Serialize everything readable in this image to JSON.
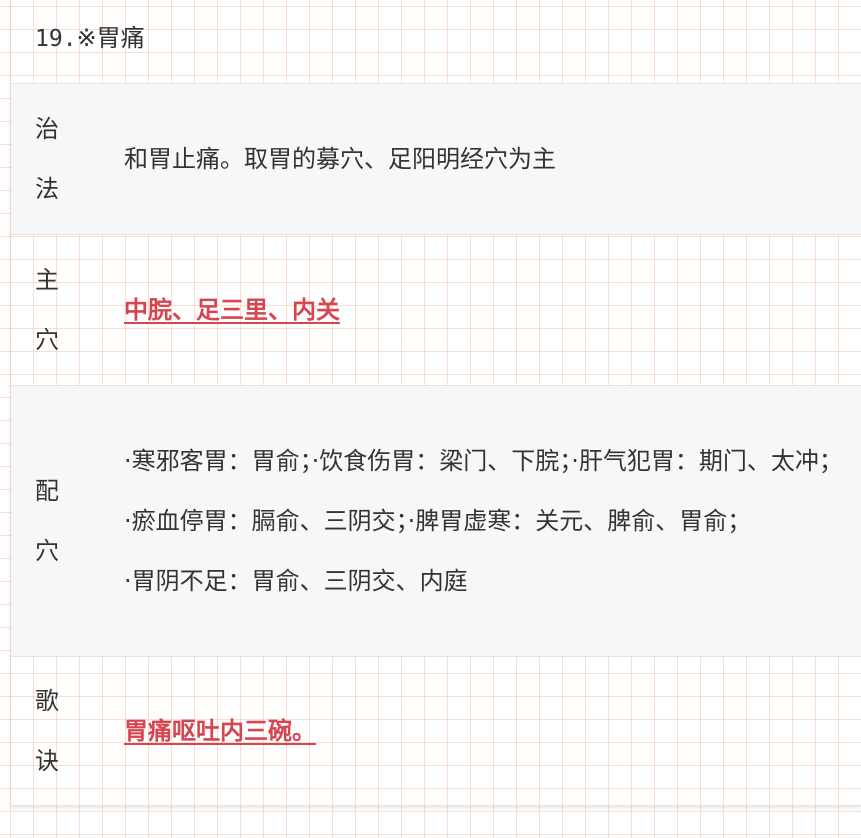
{
  "heading": {
    "number": "19.",
    "title": "※胃痛"
  },
  "rows": [
    {
      "label_chars": [
        "治",
        "法"
      ],
      "content": "和胃止痛。取胃的募穴、足阳明经穴为主"
    },
    {
      "label_chars": [
        "主",
        "穴"
      ],
      "content": "中脘、足三里、内关"
    },
    {
      "label_chars": [
        "配",
        "穴"
      ],
      "lines": [
        "·寒邪客胃：胃俞；·饮食伤胃：梁门、下脘；·肝气犯胃：期门、太冲；",
        "·瘀血停胃：膈俞、三阴交；·脾胃虚寒：关元、脾俞、胃俞；",
        "·胃阴不足：胃俞、三阴交、内庭"
      ]
    },
    {
      "label_chars": [
        "歌",
        "诀"
      ],
      "content": "胃痛呕吐内三碗。"
    }
  ],
  "colors": {
    "highlight": "#d64550",
    "row_shade": "#f6f7f9",
    "grid_line": "#f4c4aa",
    "text": "#333333"
  }
}
